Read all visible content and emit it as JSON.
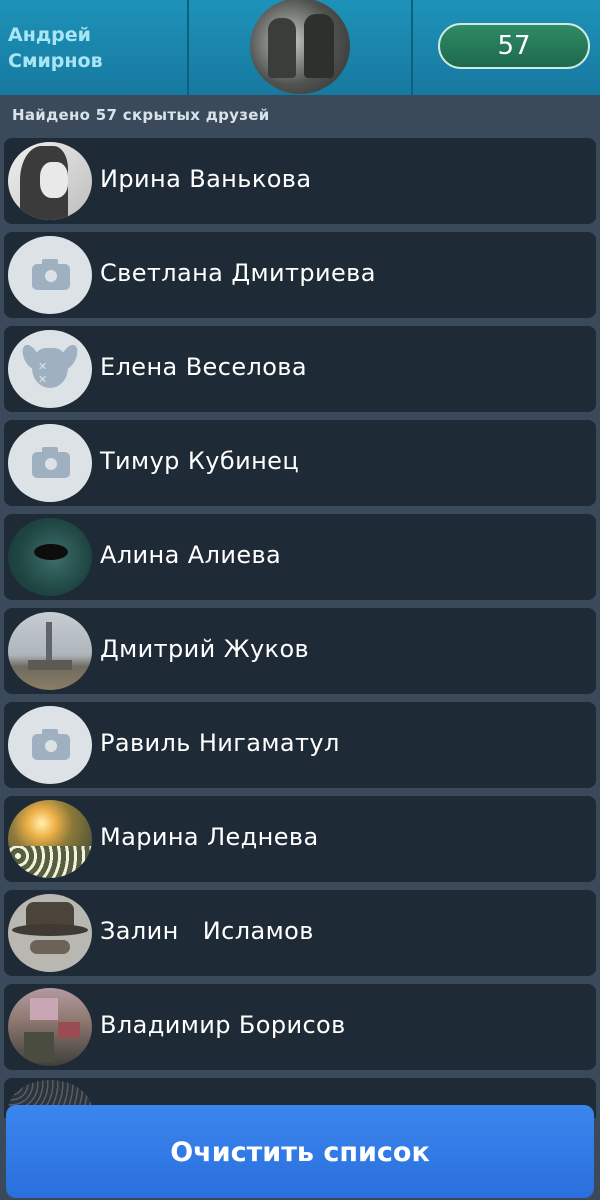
{
  "header": {
    "user_name": "Андрей\nСмирнов",
    "count": "57"
  },
  "subtitle": "Найдено 57 скрытых друзей",
  "friends": [
    {
      "name": "Ирина Ванькова",
      "avatar": "anime-girl"
    },
    {
      "name": "Светлана Дмитриева",
      "avatar": "camera-placeholder"
    },
    {
      "name": "Елена Веселова",
      "avatar": "deactivated-dog"
    },
    {
      "name": "Тимур Кубинец",
      "avatar": "camera-placeholder"
    },
    {
      "name": "Алина Алиева",
      "avatar": "photo-teal"
    },
    {
      "name": "Дмитрий Жуков",
      "avatar": "photo-tower"
    },
    {
      "name": "Равиль Нигаматул",
      "avatar": "camera-placeholder"
    },
    {
      "name": "Марина Леднева",
      "avatar": "photo-sunset"
    },
    {
      "name": "Залин   Исламов",
      "avatar": "photo-hat"
    },
    {
      "name": "Владимир Борисов",
      "avatar": "photo-blurred"
    }
  ],
  "clear_button": "Очистить список",
  "colors": {
    "header": "#1d92b8",
    "count_pill": "#2f8a66",
    "row_bg": "#1e2a36",
    "page_bg": "#3a4a5a",
    "button": "#3b86ee"
  }
}
